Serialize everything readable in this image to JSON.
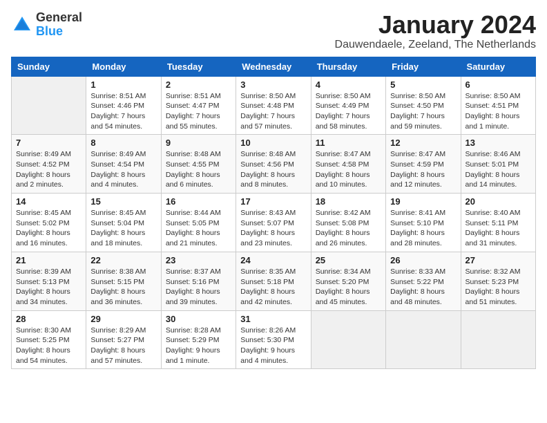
{
  "logo": {
    "general": "General",
    "blue": "Blue"
  },
  "title": "January 2024",
  "subtitle": "Dauwendaele, Zeeland, The Netherlands",
  "days": [
    "Sunday",
    "Monday",
    "Tuesday",
    "Wednesday",
    "Thursday",
    "Friday",
    "Saturday"
  ],
  "weeks": [
    [
      {
        "date": "",
        "sunrise": "",
        "sunset": "",
        "daylight": ""
      },
      {
        "date": "1",
        "sunrise": "Sunrise: 8:51 AM",
        "sunset": "Sunset: 4:46 PM",
        "daylight": "Daylight: 7 hours and 54 minutes."
      },
      {
        "date": "2",
        "sunrise": "Sunrise: 8:51 AM",
        "sunset": "Sunset: 4:47 PM",
        "daylight": "Daylight: 7 hours and 55 minutes."
      },
      {
        "date": "3",
        "sunrise": "Sunrise: 8:50 AM",
        "sunset": "Sunset: 4:48 PM",
        "daylight": "Daylight: 7 hours and 57 minutes."
      },
      {
        "date": "4",
        "sunrise": "Sunrise: 8:50 AM",
        "sunset": "Sunset: 4:49 PM",
        "daylight": "Daylight: 7 hours and 58 minutes."
      },
      {
        "date": "5",
        "sunrise": "Sunrise: 8:50 AM",
        "sunset": "Sunset: 4:50 PM",
        "daylight": "Daylight: 7 hours and 59 minutes."
      },
      {
        "date": "6",
        "sunrise": "Sunrise: 8:50 AM",
        "sunset": "Sunset: 4:51 PM",
        "daylight": "Daylight: 8 hours and 1 minute."
      }
    ],
    [
      {
        "date": "7",
        "sunrise": "Sunrise: 8:49 AM",
        "sunset": "Sunset: 4:52 PM",
        "daylight": "Daylight: 8 hours and 2 minutes."
      },
      {
        "date": "8",
        "sunrise": "Sunrise: 8:49 AM",
        "sunset": "Sunset: 4:54 PM",
        "daylight": "Daylight: 8 hours and 4 minutes."
      },
      {
        "date": "9",
        "sunrise": "Sunrise: 8:48 AM",
        "sunset": "Sunset: 4:55 PM",
        "daylight": "Daylight: 8 hours and 6 minutes."
      },
      {
        "date": "10",
        "sunrise": "Sunrise: 8:48 AM",
        "sunset": "Sunset: 4:56 PM",
        "daylight": "Daylight: 8 hours and 8 minutes."
      },
      {
        "date": "11",
        "sunrise": "Sunrise: 8:47 AM",
        "sunset": "Sunset: 4:58 PM",
        "daylight": "Daylight: 8 hours and 10 minutes."
      },
      {
        "date": "12",
        "sunrise": "Sunrise: 8:47 AM",
        "sunset": "Sunset: 4:59 PM",
        "daylight": "Daylight: 8 hours and 12 minutes."
      },
      {
        "date": "13",
        "sunrise": "Sunrise: 8:46 AM",
        "sunset": "Sunset: 5:01 PM",
        "daylight": "Daylight: 8 hours and 14 minutes."
      }
    ],
    [
      {
        "date": "14",
        "sunrise": "Sunrise: 8:45 AM",
        "sunset": "Sunset: 5:02 PM",
        "daylight": "Daylight: 8 hours and 16 minutes."
      },
      {
        "date": "15",
        "sunrise": "Sunrise: 8:45 AM",
        "sunset": "Sunset: 5:04 PM",
        "daylight": "Daylight: 8 hours and 18 minutes."
      },
      {
        "date": "16",
        "sunrise": "Sunrise: 8:44 AM",
        "sunset": "Sunset: 5:05 PM",
        "daylight": "Daylight: 8 hours and 21 minutes."
      },
      {
        "date": "17",
        "sunrise": "Sunrise: 8:43 AM",
        "sunset": "Sunset: 5:07 PM",
        "daylight": "Daylight: 8 hours and 23 minutes."
      },
      {
        "date": "18",
        "sunrise": "Sunrise: 8:42 AM",
        "sunset": "Sunset: 5:08 PM",
        "daylight": "Daylight: 8 hours and 26 minutes."
      },
      {
        "date": "19",
        "sunrise": "Sunrise: 8:41 AM",
        "sunset": "Sunset: 5:10 PM",
        "daylight": "Daylight: 8 hours and 28 minutes."
      },
      {
        "date": "20",
        "sunrise": "Sunrise: 8:40 AM",
        "sunset": "Sunset: 5:11 PM",
        "daylight": "Daylight: 8 hours and 31 minutes."
      }
    ],
    [
      {
        "date": "21",
        "sunrise": "Sunrise: 8:39 AM",
        "sunset": "Sunset: 5:13 PM",
        "daylight": "Daylight: 8 hours and 34 minutes."
      },
      {
        "date": "22",
        "sunrise": "Sunrise: 8:38 AM",
        "sunset": "Sunset: 5:15 PM",
        "daylight": "Daylight: 8 hours and 36 minutes."
      },
      {
        "date": "23",
        "sunrise": "Sunrise: 8:37 AM",
        "sunset": "Sunset: 5:16 PM",
        "daylight": "Daylight: 8 hours and 39 minutes."
      },
      {
        "date": "24",
        "sunrise": "Sunrise: 8:35 AM",
        "sunset": "Sunset: 5:18 PM",
        "daylight": "Daylight: 8 hours and 42 minutes."
      },
      {
        "date": "25",
        "sunrise": "Sunrise: 8:34 AM",
        "sunset": "Sunset: 5:20 PM",
        "daylight": "Daylight: 8 hours and 45 minutes."
      },
      {
        "date": "26",
        "sunrise": "Sunrise: 8:33 AM",
        "sunset": "Sunset: 5:22 PM",
        "daylight": "Daylight: 8 hours and 48 minutes."
      },
      {
        "date": "27",
        "sunrise": "Sunrise: 8:32 AM",
        "sunset": "Sunset: 5:23 PM",
        "daylight": "Daylight: 8 hours and 51 minutes."
      }
    ],
    [
      {
        "date": "28",
        "sunrise": "Sunrise: 8:30 AM",
        "sunset": "Sunset: 5:25 PM",
        "daylight": "Daylight: 8 hours and 54 minutes."
      },
      {
        "date": "29",
        "sunrise": "Sunrise: 8:29 AM",
        "sunset": "Sunset: 5:27 PM",
        "daylight": "Daylight: 8 hours and 57 minutes."
      },
      {
        "date": "30",
        "sunrise": "Sunrise: 8:28 AM",
        "sunset": "Sunset: 5:29 PM",
        "daylight": "Daylight: 9 hours and 1 minute."
      },
      {
        "date": "31",
        "sunrise": "Sunrise: 8:26 AM",
        "sunset": "Sunset: 5:30 PM",
        "daylight": "Daylight: 9 hours and 4 minutes."
      },
      {
        "date": "",
        "sunrise": "",
        "sunset": "",
        "daylight": ""
      },
      {
        "date": "",
        "sunrise": "",
        "sunset": "",
        "daylight": ""
      },
      {
        "date": "",
        "sunrise": "",
        "sunset": "",
        "daylight": ""
      }
    ]
  ]
}
